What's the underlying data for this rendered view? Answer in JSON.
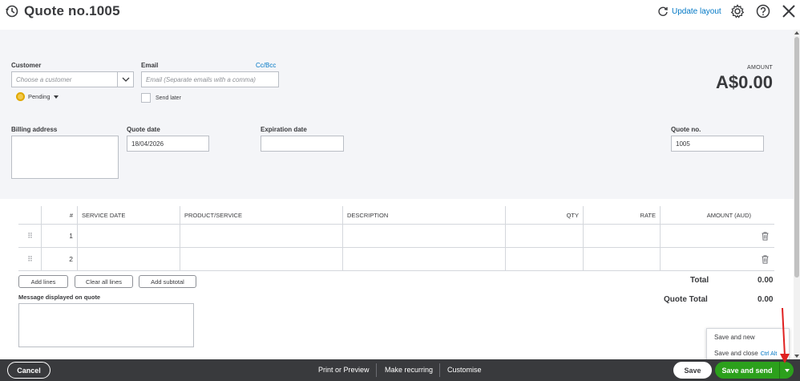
{
  "header": {
    "title": "Quote no.1005",
    "update_layout": "Update layout",
    "icons": [
      "history-icon",
      "refresh-icon",
      "gear-icon",
      "help-icon",
      "close-icon"
    ]
  },
  "form": {
    "customer": {
      "label": "Customer",
      "placeholder": "Choose a customer"
    },
    "email": {
      "label": "Email",
      "placeholder": "Email (Separate emails with a comma)",
      "cc_bcc": "Cc/Bcc"
    },
    "status": "Pending",
    "send_later": "Send later",
    "amount": {
      "label": "AMOUNT",
      "value": "A$0.00"
    },
    "billing_address": {
      "label": "Billing address"
    },
    "quote_date": {
      "label": "Quote date",
      "value": "18/04/2026"
    },
    "expiration_date": {
      "label": "Expiration date",
      "value": ""
    },
    "quote_no": {
      "label": "Quote no.",
      "value": "1005"
    }
  },
  "table": {
    "headers": [
      "#",
      "SERVICE DATE",
      "PRODUCT/SERVICE",
      "DESCRIPTION",
      "QTY",
      "RATE",
      "AMOUNT (AUD)"
    ],
    "rows": [
      {
        "num": "1",
        "service_date": "",
        "product": "",
        "description": "",
        "qty": "",
        "rate": "",
        "amount": ""
      },
      {
        "num": "2",
        "service_date": "",
        "product": "",
        "description": "",
        "qty": "",
        "rate": "",
        "amount": ""
      }
    ]
  },
  "actions": {
    "add_lines": "Add lines",
    "clear_all_lines": "Clear all lines",
    "add_subtotal": "Add subtotal"
  },
  "totals": {
    "total_label": "Total",
    "total_value": "0.00",
    "quote_total_label": "Quote Total",
    "quote_total_value": "0.00"
  },
  "message": {
    "label": "Message displayed on quote"
  },
  "menu": {
    "save_and_new": "Save and new",
    "save_and_close": "Save and close",
    "save_and_close_shortcut": "Ctrl Alt"
  },
  "footer": {
    "cancel": "Cancel",
    "print_or_preview": "Print or Preview",
    "make_recurring": "Make recurring",
    "customise": "Customise",
    "save": "Save",
    "save_and_send": "Save and send"
  },
  "colors": {
    "brand_green": "#2ca01c",
    "link_blue": "#0077c5",
    "footer_bg": "#393a3d",
    "annotation_red": "#e02020"
  }
}
